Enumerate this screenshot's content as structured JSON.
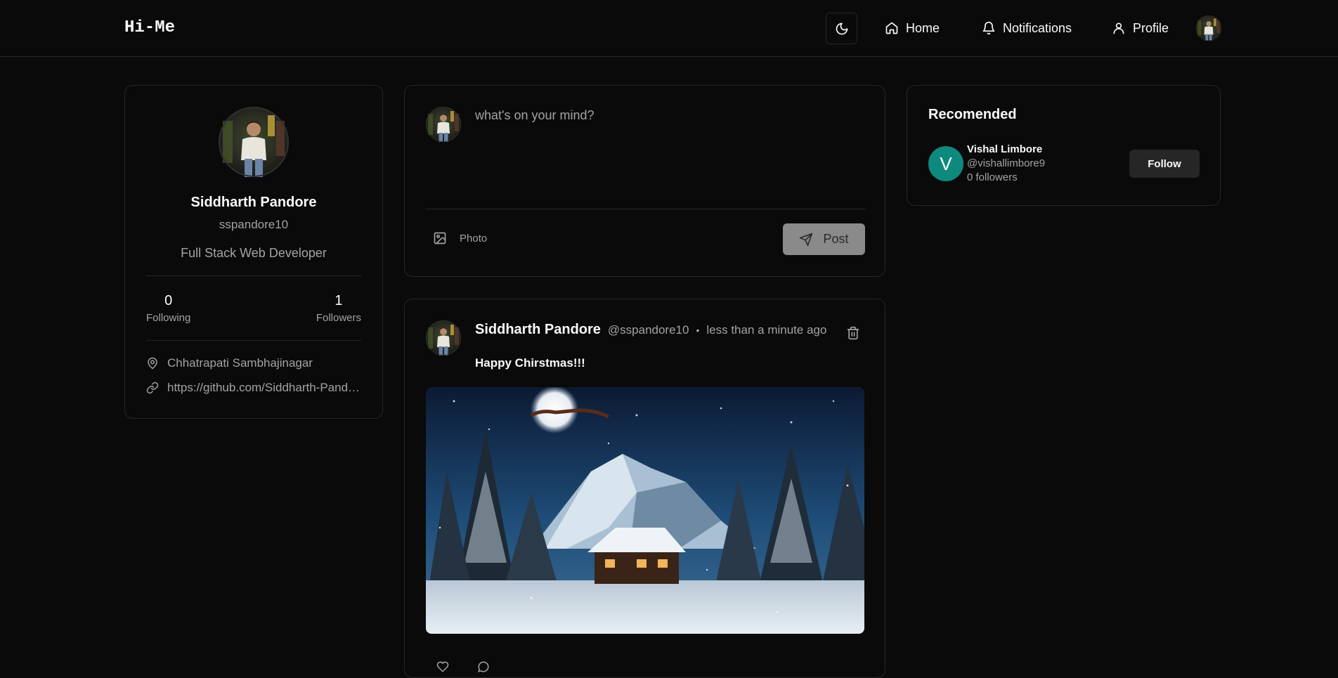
{
  "header": {
    "logo": "Hi-Me",
    "nav": {
      "home": "Home",
      "notifications": "Notifications",
      "profile": "Profile"
    }
  },
  "profile_card": {
    "name": "Siddharth Pandore",
    "username": "sspandore10",
    "bio": "Full Stack Web Developer",
    "following_count": "0",
    "following_label": "Following",
    "followers_count": "1",
    "followers_label": "Followers",
    "location": "Chhatrapati Sambhajinagar",
    "website": "https://github.com/Siddharth-Pandore"
  },
  "composer": {
    "placeholder": "what's on your mind?",
    "photo_label": "Photo",
    "post_label": "Post"
  },
  "post": {
    "author_name": "Siddharth Pandore",
    "author_handle": "@sspandore10",
    "separator": "•",
    "time": "less than a minute ago",
    "content": "Happy Chirstmas!!!"
  },
  "recommended": {
    "title": "Recomended",
    "users": [
      {
        "initial": "V",
        "name": "Vishal Limbore",
        "handle": "@vishallimbore9",
        "followers": "0 followers",
        "follow_label": "Follow"
      }
    ]
  },
  "colors": {
    "background": "#0a0a0a",
    "border": "#262626",
    "muted_text": "#a3a3a3",
    "rec_avatar": "#0d8a7d",
    "post_button": "#8a8a8a"
  },
  "icons": [
    "moon-icon",
    "home-icon",
    "bell-icon",
    "user-icon",
    "map-pin-icon",
    "link-icon",
    "image-icon",
    "send-icon",
    "trash-icon",
    "heart-icon",
    "comment-icon"
  ]
}
